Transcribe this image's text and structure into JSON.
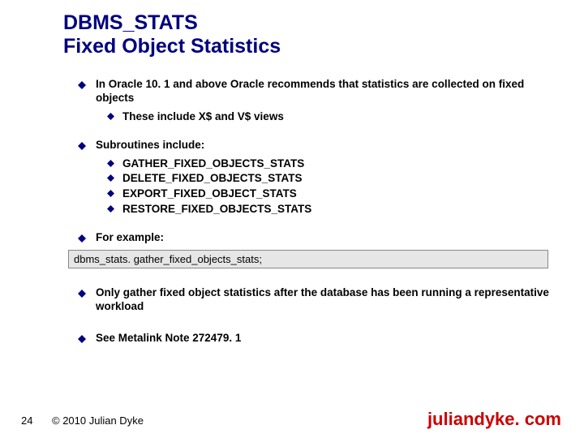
{
  "title": {
    "line1": "DBMS_STATS",
    "line2": "Fixed Object Statistics"
  },
  "bullets": {
    "b1": "In Oracle 10. 1 and above Oracle recommends that statistics are collected on fixed objects",
    "b1_sub1": "These include X$ and V$ views",
    "b2": "Subroutines include:",
    "b2_sub1": "GATHER_FIXED_OBJECTS_STATS",
    "b2_sub2": "DELETE_FIXED_OBJECTS_STATS",
    "b2_sub3": "EXPORT_FIXED_OBJECT_STATS",
    "b2_sub4": "RESTORE_FIXED_OBJECTS_STATS",
    "b3": "For example:",
    "code": "dbms_stats. gather_fixed_objects_stats;",
    "b4": "Only gather fixed object statistics after the database has been running a representative workload",
    "b5": "See Metalink Note 272479. 1"
  },
  "footer": {
    "page": "24",
    "copyright": "© 2010 Julian Dyke",
    "site": "juliandyke. com"
  },
  "colors": {
    "bullet": "#000080",
    "title": "#000080",
    "site": "#cc0000"
  }
}
